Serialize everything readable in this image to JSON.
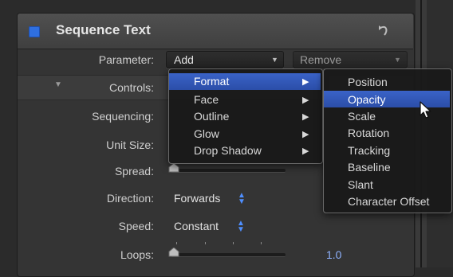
{
  "panel": {
    "title": "Sequence Text",
    "accent_color": "#2f6fe0",
    "reset_icon": "reset-arrow-icon"
  },
  "rows": {
    "parameter_label": "Parameter:",
    "add_value": "Add",
    "remove_value": "Remove",
    "controls_label": "Controls:",
    "sequencing_label": "Sequencing:",
    "unit_size_label": "Unit Size:",
    "spread_label": "Spread:",
    "direction_label": "Direction:",
    "direction_value": "Forwards",
    "speed_label": "Speed:",
    "speed_value": "Constant",
    "loops_label": "Loops:",
    "loops_value": "1.0"
  },
  "add_menu": {
    "items": [
      "Format",
      "Face",
      "Outline",
      "Glow",
      "Drop Shadow"
    ],
    "highlighted": "Format",
    "highlight_color": "#3a63c7"
  },
  "format_submenu": {
    "items": [
      "Position",
      "Opacity",
      "Scale",
      "Rotation",
      "Tracking",
      "Baseline",
      "Slant",
      "Character Offset"
    ],
    "highlighted": "Opacity"
  }
}
